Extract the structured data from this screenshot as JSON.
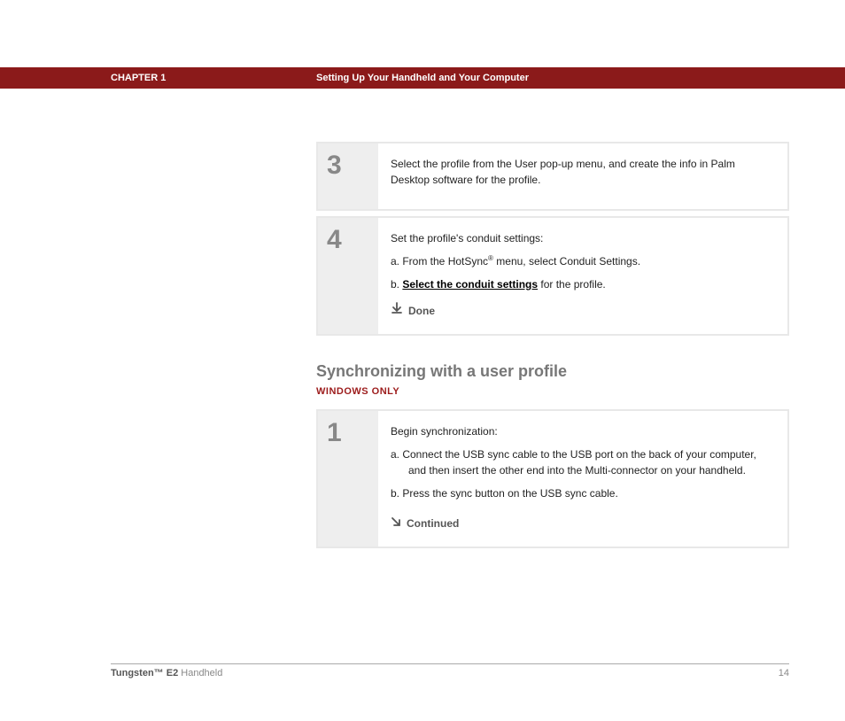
{
  "header": {
    "chapter": "CHAPTER 1",
    "title": "Setting Up Your Handheld and Your Computer"
  },
  "steps_top": [
    {
      "num": "3",
      "intro": "Select the profile from the User pop-up menu, and create the info in Palm Desktop software for the profile."
    },
    {
      "num": "4",
      "intro": "Set the profile's conduit settings:",
      "items": {
        "a_pre": "a.  From the HotSync",
        "a_sup": "®",
        "a_post": " menu, select Conduit Settings.",
        "b_pre": "b.  ",
        "b_link": "Select the conduit settings",
        "b_post": " for the profile."
      },
      "done": "Done"
    }
  ],
  "section": {
    "heading": "Synchronizing with a user profile",
    "sub": "WINDOWS ONLY"
  },
  "steps_bottom": [
    {
      "num": "1",
      "intro": "Begin synchronization:",
      "items": {
        "a": "a.  Connect the USB sync cable to the USB port on the back of your computer, and then insert the other end into the Multi-connector on your handheld.",
        "b": "b.  Press the sync button on the USB sync cable."
      },
      "continued": "Continued"
    }
  ],
  "footer": {
    "product_bold": "Tungsten™ E2",
    "product_rest": " Handheld",
    "page": "14"
  }
}
